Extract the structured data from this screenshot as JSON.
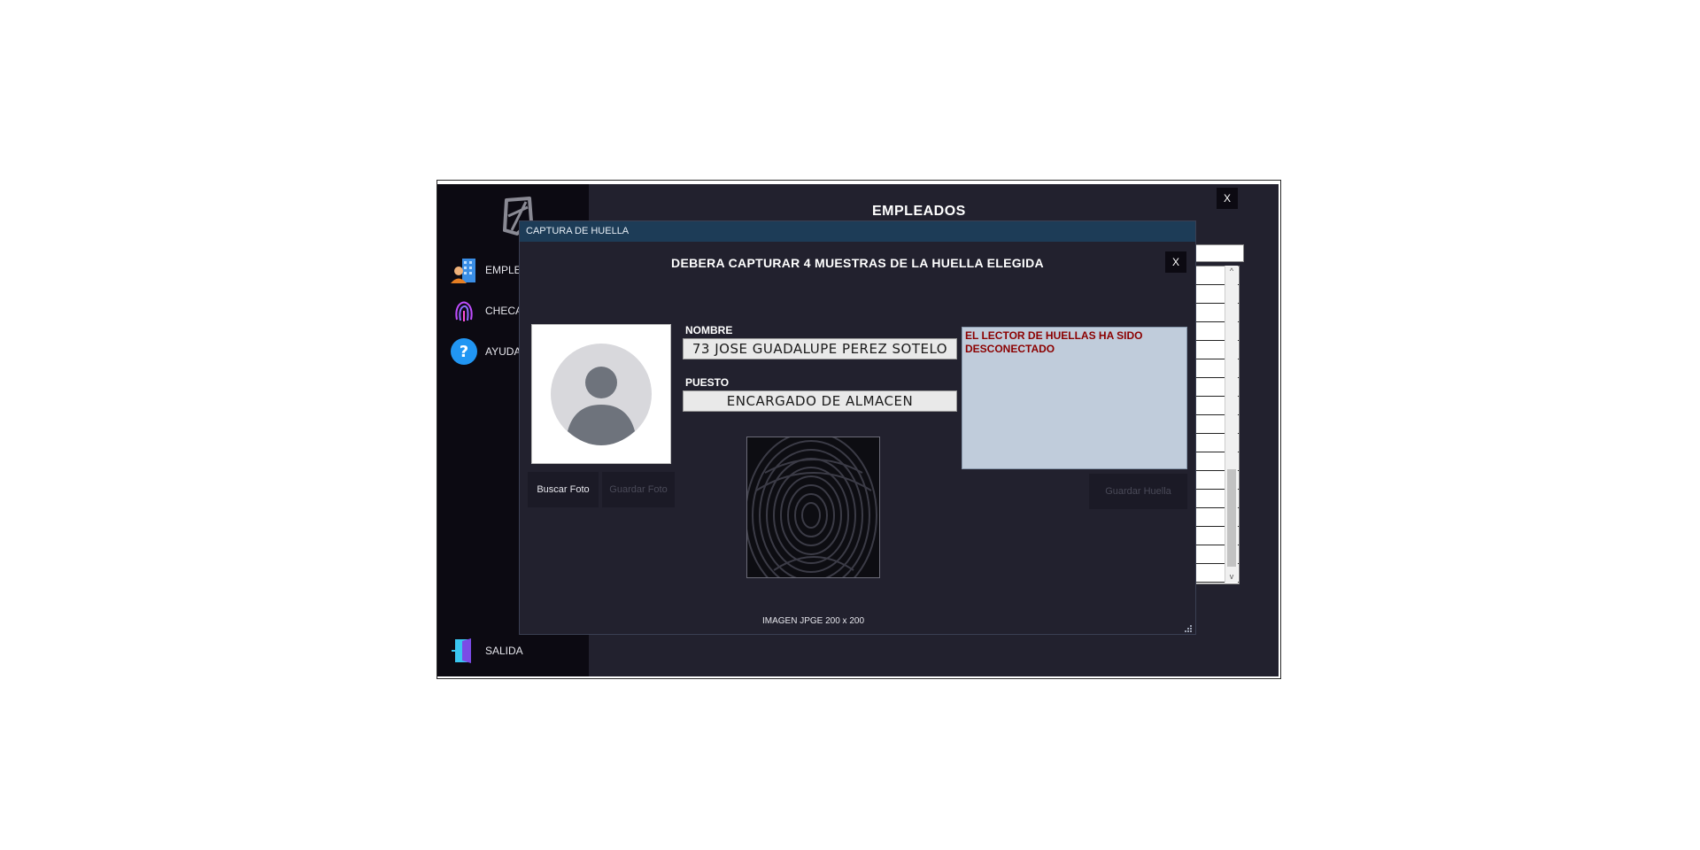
{
  "app": {
    "title": "EMPLEADOS",
    "close_label": "X",
    "sidebar": {
      "items": [
        {
          "label": "EMPLEADOS",
          "icon": "employee-building-icon"
        },
        {
          "label": "CHECADOR",
          "icon": "fingerprint-icon"
        },
        {
          "label": "AYUDA",
          "icon": "help-icon"
        }
      ],
      "exit_label": "SALIDA",
      "exit_icon": "exit-door-icon"
    }
  },
  "dialog": {
    "title": "CAPTURA DE HUELLA",
    "heading": "DEBERA CAPTURAR 4 MUESTRAS DE LA HUELLA ELEGIDA",
    "close_label": "X",
    "nombre_label": "NOMBRE",
    "nombre_value": "73 JOSE GUADALUPE PEREZ SOTELO",
    "puesto_label": "PUESTO",
    "puesto_value": "ENCARGADO DE ALMACEN",
    "buscar_foto_label": "Buscar Foto",
    "guardar_foto_label": "Guardar Foto",
    "guardar_huella_label": "Guardar Huella",
    "message": "EL LECTOR DE HUELLAS HA SIDO DESCONECTADO",
    "image_caption": "IMAGEN JPGE 200 x 200"
  },
  "colors": {
    "app_bg": "#22212e",
    "sidebar_bg": "#0c0a12",
    "titlebar_bg": "#1d3c57",
    "message_text": "#8b0000",
    "message_bg": "#c0ccdb"
  }
}
